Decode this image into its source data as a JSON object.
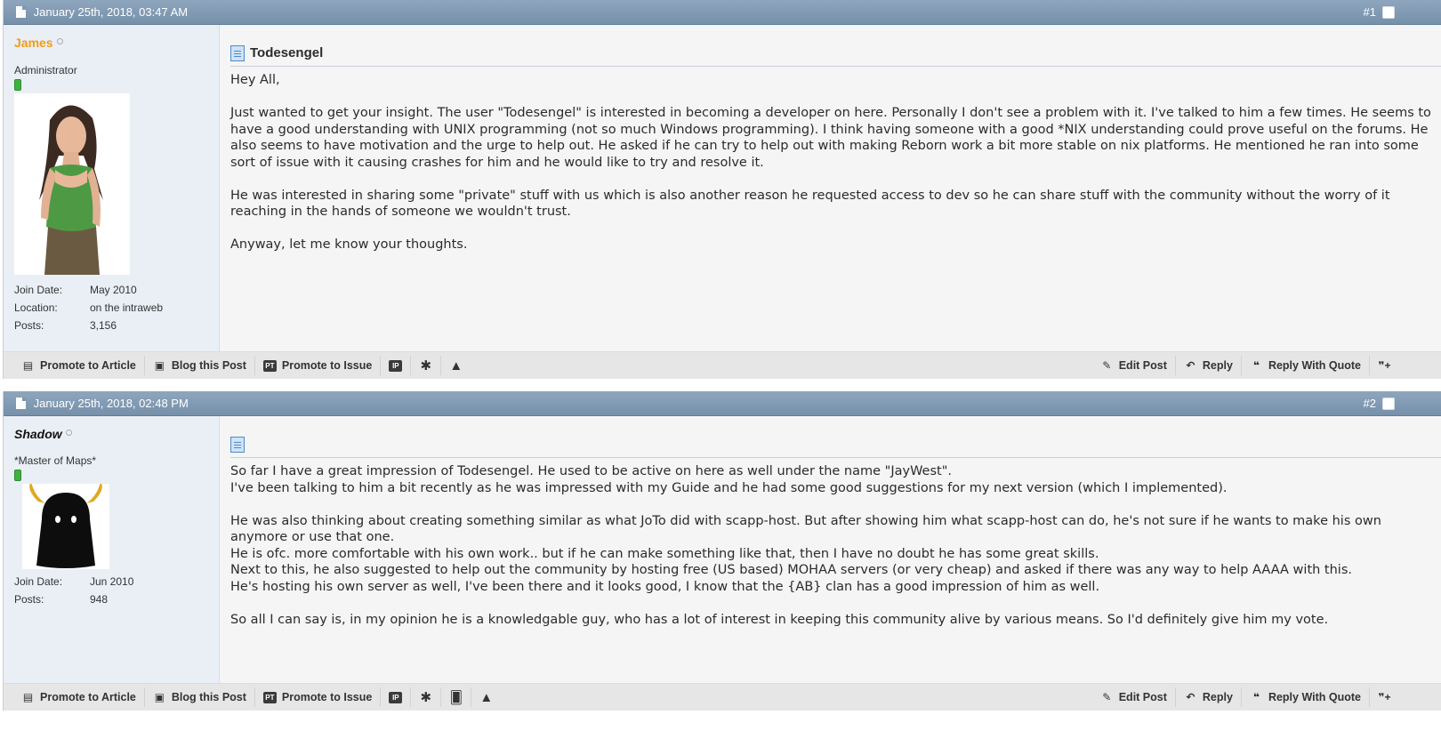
{
  "posts": [
    {
      "date": "January 25th, 2018, 03:47 AM",
      "number": "#1",
      "username": "James",
      "username_color": "#f39c12",
      "user_title": "Administrator",
      "stats": [
        {
          "label": "Join Date:",
          "value": "May 2010"
        },
        {
          "label": "Location:",
          "value": "on the intraweb"
        },
        {
          "label": "Posts:",
          "value": "3,156"
        }
      ],
      "title": "Todesengel",
      "message": "Hey All,\n\nJust wanted to get your insight. The user \"Todesengel\" is interested in becoming a developer on here. Personally I don't see a problem with it. I've talked to him a few times. He seems to have a good understanding with UNIX programming (not so much Windows programming). I think having someone with a good *NIX understanding could prove useful on the forums. He also seems to have motivation and the urge to help out. He asked if he can try to help out with making Reborn work a bit more stable on nix platforms. He mentioned he ran into some sort of issue with it causing crashes for him and he would like to try and resolve it.\n\nHe was interested in sharing some \"private\" stuff with us which is also another reason he requested access to dev so he can share stuff with the community without the worry of it reaching in the hands of someone we wouldn't trust.\n\nAnyway, let me know your thoughts."
    },
    {
      "date": "January 25th, 2018, 02:48 PM",
      "number": "#2",
      "username": "Shadow",
      "username_color": "#111111",
      "user_title": "*Master of Maps*",
      "stats": [
        {
          "label": "Join Date:",
          "value": "Jun 2010"
        },
        {
          "label": "Posts:",
          "value": "948"
        }
      ],
      "title": "",
      "message": "So far I have a great impression of Todesengel. He used to be active on here as well under the name \"JayWest\".\nI've been talking to him a bit recently as he was impressed with my Guide and he had some good suggestions for my next version (which I implemented).\n\nHe was also thinking about creating something similar as what JoTo did with scapp-host. But after showing him what scapp-host can do, he's not sure if he wants to make his own anymore or use that one.\nHe is ofc. more comfortable with his own work.. but if he can make something like that, then I have no doubt he has some great skills.\nNext to this, he also suggested to help out the community by hosting free (US based) MOHAA servers (or very cheap) and asked if there was any way to help AAAA with this.\nHe's hosting his own server as well, I've been there and it looks good, I know that the {AB} clan has a good impression of him as well.\n\nSo all I can say is, in my opinion he is a knowledgable guy, who has a lot of interest in keeping this community alive by various means. So I'd definitely give him my vote."
    }
  ],
  "footer": {
    "promote_article": "Promote to Article",
    "blog_post": "Blog this Post",
    "promote_issue": "Promote to Issue",
    "edit_post": "Edit Post",
    "reply": "Reply",
    "reply_quote": "Reply With Quote"
  }
}
